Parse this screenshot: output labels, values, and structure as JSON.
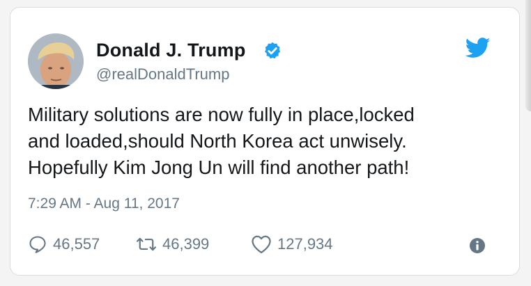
{
  "user": {
    "display_name": "Donald J. Trump",
    "handle": "@realDonaldTrump"
  },
  "tweet": {
    "lines": [
      "Military solutions are now fully in place,locked",
      "and loaded,should North Korea act unwisely.",
      "Hopefully Kim Jong Un will find another path!"
    ],
    "timestamp": "7:29 AM - Aug 11, 2017"
  },
  "stats": {
    "replies": "46,557",
    "retweets": "46,399",
    "likes": "127,934"
  },
  "icons": {
    "verified": "verified-badge-icon",
    "brand": "twitter-bird-icon",
    "reply": "reply-icon",
    "retweet": "retweet-icon",
    "like": "heart-icon",
    "info": "info-icon"
  },
  "colors": {
    "brand_blue": "#1da1f2",
    "text": "#14171a",
    "secondary": "#657786"
  }
}
